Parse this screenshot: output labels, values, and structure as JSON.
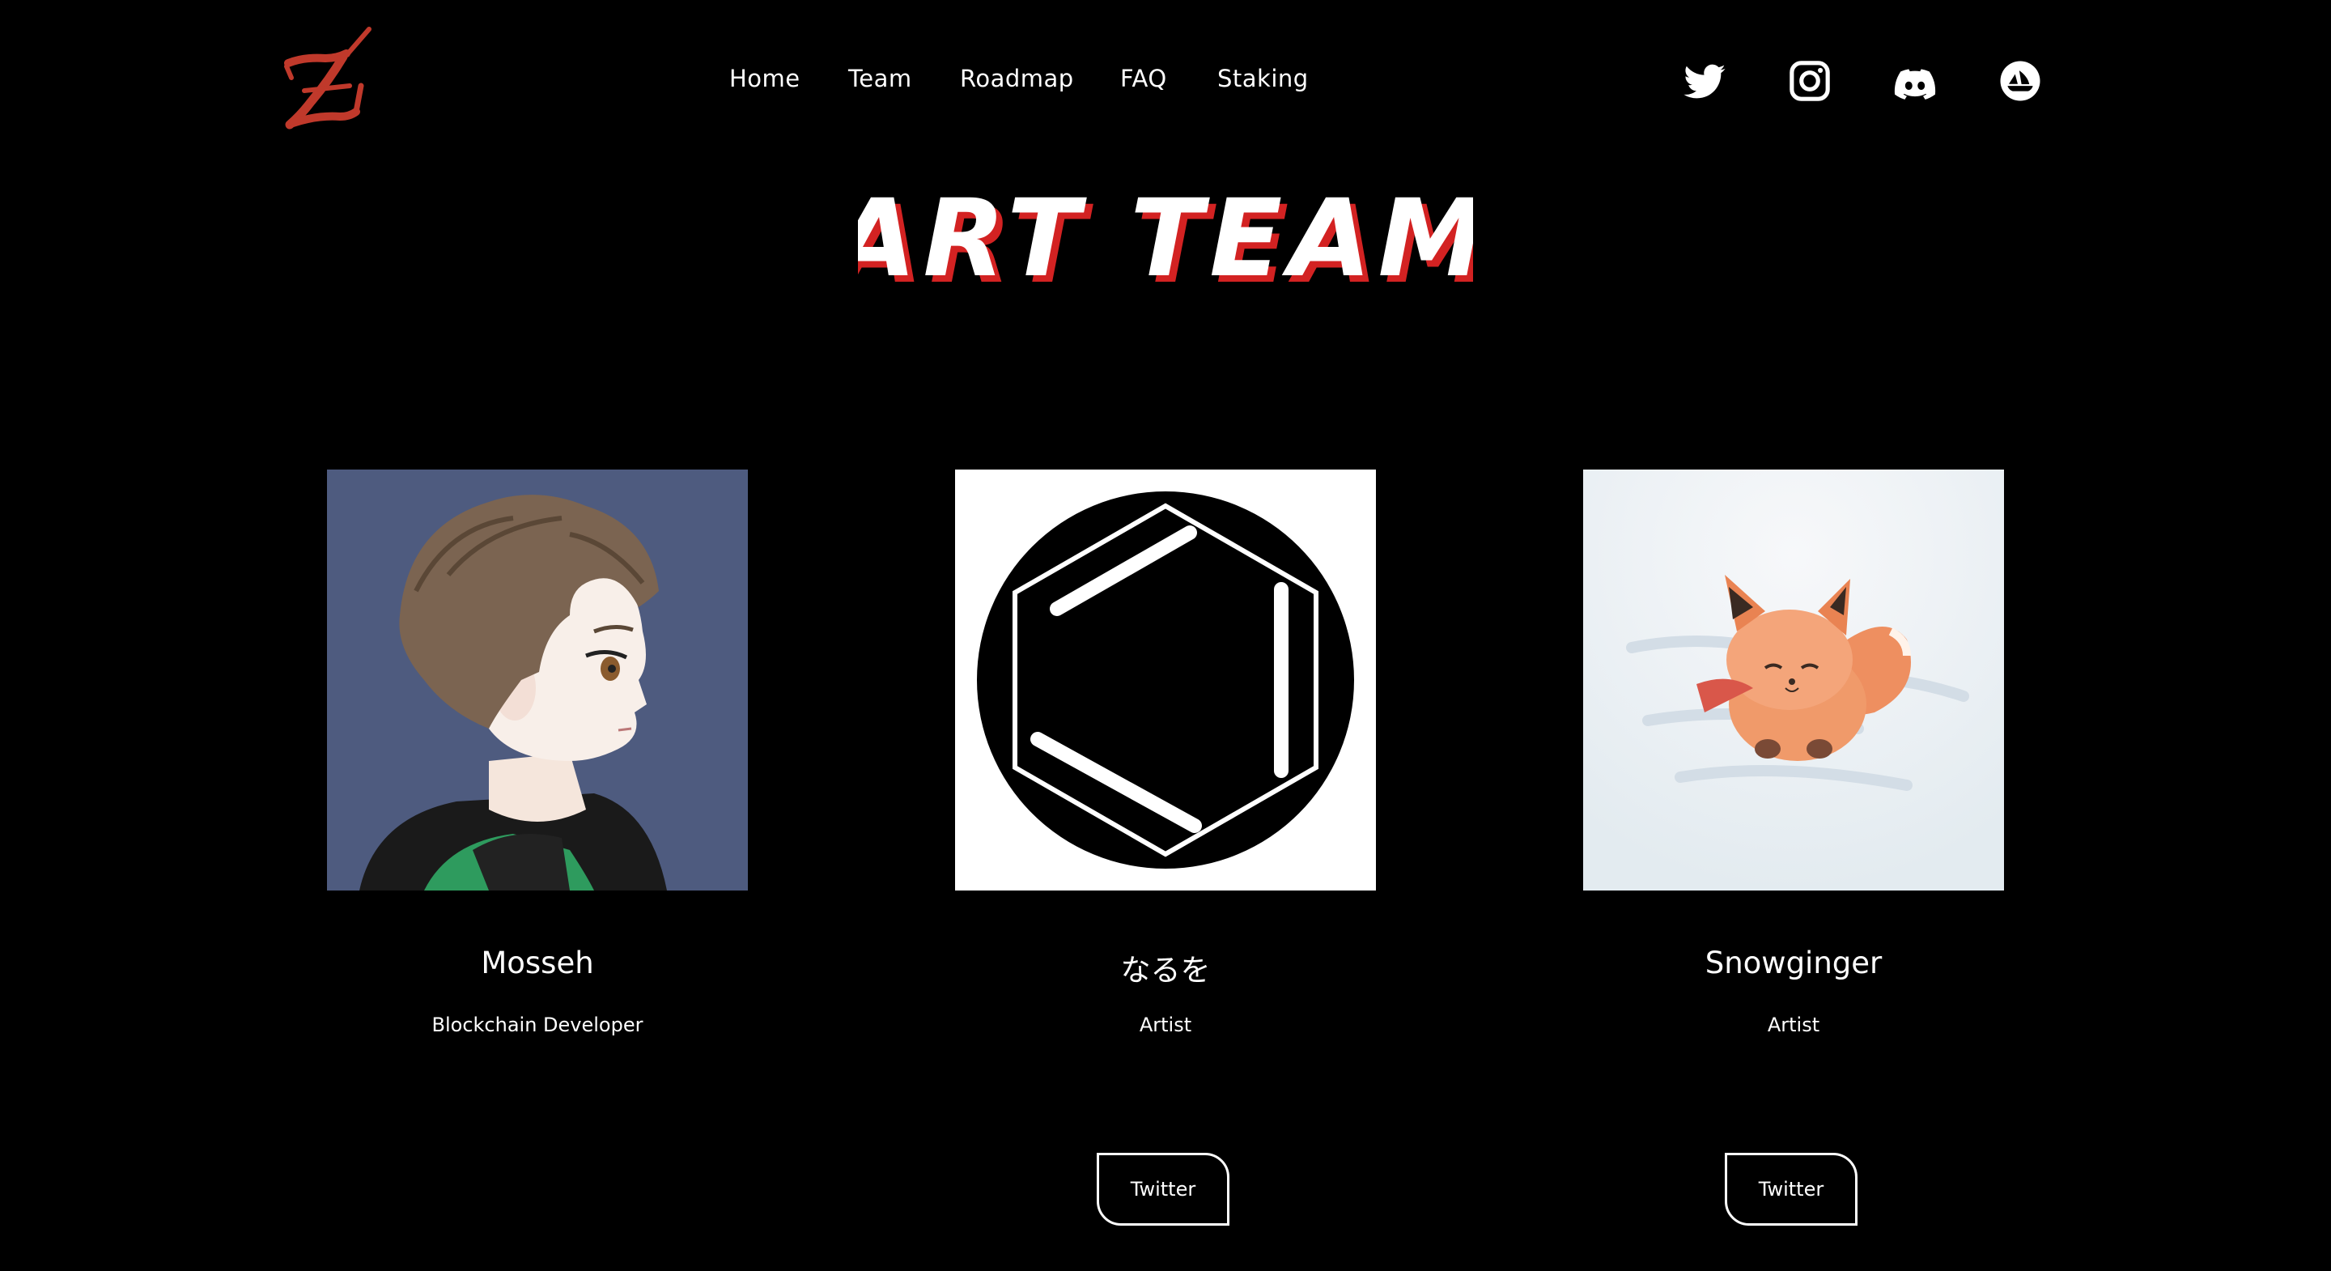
{
  "logo": {
    "letter": "Z",
    "color": "#c0392b"
  },
  "nav": {
    "items": [
      {
        "label": "Home"
      },
      {
        "label": "Team"
      },
      {
        "label": "Roadmap"
      },
      {
        "label": "FAQ"
      },
      {
        "label": "Staking"
      }
    ]
  },
  "social": {
    "icons": [
      "twitter-icon",
      "instagram-icon",
      "discord-icon",
      "opensea-icon"
    ]
  },
  "section": {
    "title": "ART TEAM",
    "title_color": "#ffffff",
    "title_shadow_color": "#d32222"
  },
  "team": [
    {
      "name": "Mosseh",
      "role": "Blockchain Developer",
      "button": ""
    },
    {
      "name": "なるを",
      "role": "Artist",
      "button": "Twitter"
    },
    {
      "name": "Snowginger",
      "role": "Artist",
      "button": "Twitter"
    }
  ],
  "colors": {
    "background": "#000000",
    "text": "#ffffff",
    "accent": "#c0392b"
  }
}
